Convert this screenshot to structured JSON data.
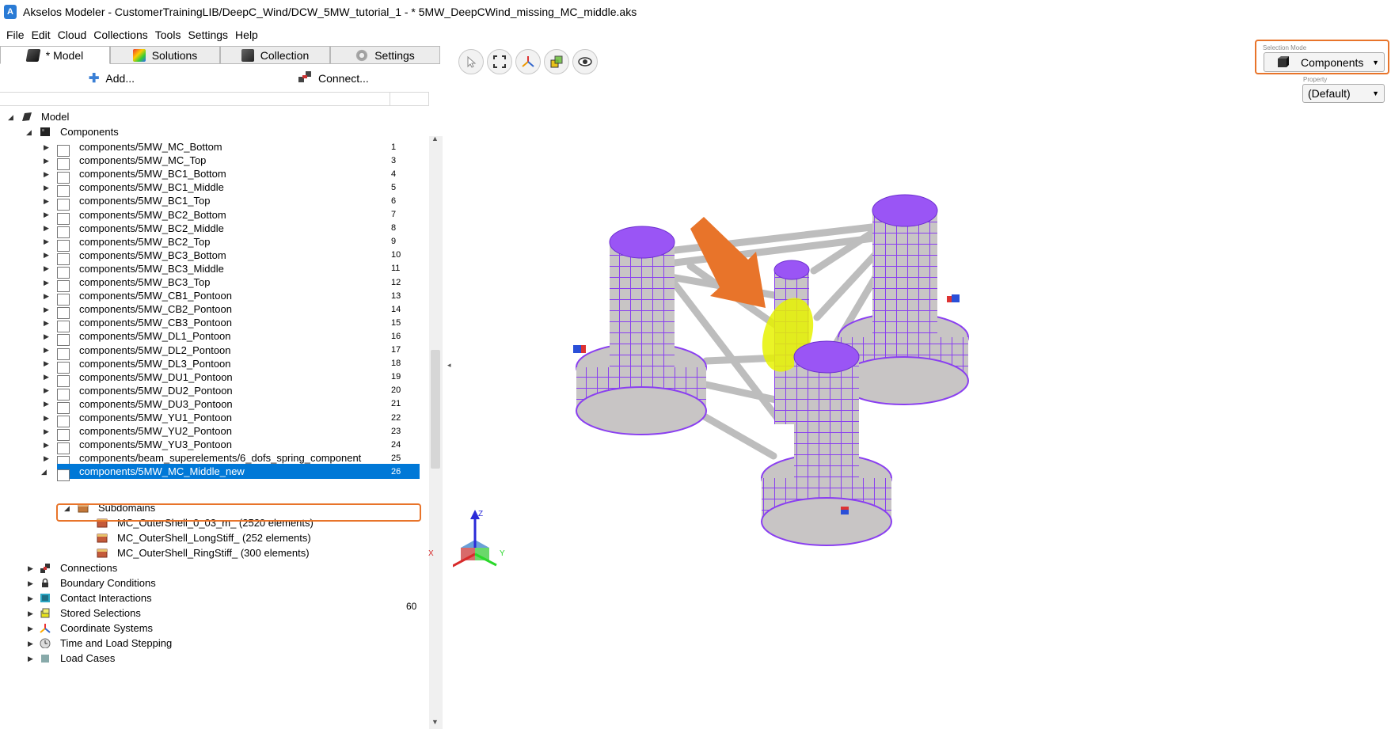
{
  "window": {
    "title": "Akselos Modeler - CustomerTrainingLIB/DeepC_Wind/DCW_5MW_tutorial_1 - * 5MW_DeepCWind_missing_MC_middle.aks"
  },
  "menu": {
    "items": [
      "File",
      "Edit",
      "Cloud",
      "Collections",
      "Tools",
      "Settings",
      "Help"
    ]
  },
  "tabs": [
    {
      "label": "* Model",
      "icon": "model-icon",
      "active": true
    },
    {
      "label": "Solutions",
      "icon": "solutions-icon",
      "active": false
    },
    {
      "label": "Collection",
      "icon": "collection-icon",
      "active": false
    },
    {
      "label": "Settings",
      "icon": "settings-gear-icon",
      "active": false
    }
  ],
  "actions": {
    "add_label": "Add...",
    "connect_label": "Connect..."
  },
  "tree": {
    "root_label": "Model",
    "components_label": "Components",
    "components": [
      {
        "name": "components/5MW_MC_Bottom",
        "id": "1"
      },
      {
        "name": "components/5MW_MC_Top",
        "id": "3"
      },
      {
        "name": "components/5MW_BC1_Bottom",
        "id": "4"
      },
      {
        "name": "components/5MW_BC1_Middle",
        "id": "5"
      },
      {
        "name": "components/5MW_BC1_Top",
        "id": "6"
      },
      {
        "name": "components/5MW_BC2_Bottom",
        "id": "7"
      },
      {
        "name": "components/5MW_BC2_Middle",
        "id": "8"
      },
      {
        "name": "components/5MW_BC2_Top",
        "id": "9"
      },
      {
        "name": "components/5MW_BC3_Bottom",
        "id": "10"
      },
      {
        "name": "components/5MW_BC3_Middle",
        "id": "11"
      },
      {
        "name": "components/5MW_BC3_Top",
        "id": "12"
      },
      {
        "name": "components/5MW_CB1_Pontoon",
        "id": "13"
      },
      {
        "name": "components/5MW_CB2_Pontoon",
        "id": "14"
      },
      {
        "name": "components/5MW_CB3_Pontoon",
        "id": "15"
      },
      {
        "name": "components/5MW_DL1_Pontoon",
        "id": "16"
      },
      {
        "name": "components/5MW_DL2_Pontoon",
        "id": "17"
      },
      {
        "name": "components/5MW_DL3_Pontoon",
        "id": "18"
      },
      {
        "name": "components/5MW_DU1_Pontoon",
        "id": "19"
      },
      {
        "name": "components/5MW_DU2_Pontoon",
        "id": "20"
      },
      {
        "name": "components/5MW_DU3_Pontoon",
        "id": "21"
      },
      {
        "name": "components/5MW_YU1_Pontoon",
        "id": "22"
      },
      {
        "name": "components/5MW_YU2_Pontoon",
        "id": "23"
      },
      {
        "name": "components/5MW_YU3_Pontoon",
        "id": "24"
      },
      {
        "name": "components/beam_superelements/6_dofs_spring_component",
        "id": "25"
      },
      {
        "name": "components/5MW_MC_Middle_new",
        "id": "26",
        "selected": true
      }
    ],
    "subdomains_label": "Subdomains",
    "subdomains": [
      "MC_OuterShell_0_03_m_ (2520 elements)",
      "MC_OuterShell_LongStiff_ (252 elements)",
      "MC_OuterShell_RingStiff_ (300 elements)"
    ],
    "sections": [
      {
        "label": "Connections",
        "icon": "connections-icon"
      },
      {
        "label": "Boundary Conditions",
        "icon": "lock-icon"
      },
      {
        "label": "Contact Interactions",
        "icon": "contact-icon"
      },
      {
        "label": "Stored Selections",
        "icon": "stored-selections-icon"
      },
      {
        "label": "Coordinate Systems",
        "icon": "coordinate-axes-icon"
      },
      {
        "label": "Time and Load Stepping",
        "icon": "clock-icon"
      },
      {
        "label": "Load Cases",
        "icon": "load-cases-icon"
      }
    ]
  },
  "viewport": {
    "selection_mode_label": "Selection Mode",
    "selection_mode_value": "Components",
    "property_label": "Property",
    "property_value": "(Default)",
    "status_number": "60",
    "axes": {
      "z": "Z",
      "x": "X",
      "y": "Y"
    }
  },
  "colors": {
    "selection": "#0078d7",
    "highlight": "#e8742a",
    "mesh": "#8a3ff0",
    "shell": "#c9c6c6",
    "selected_component": "#e6f200"
  }
}
